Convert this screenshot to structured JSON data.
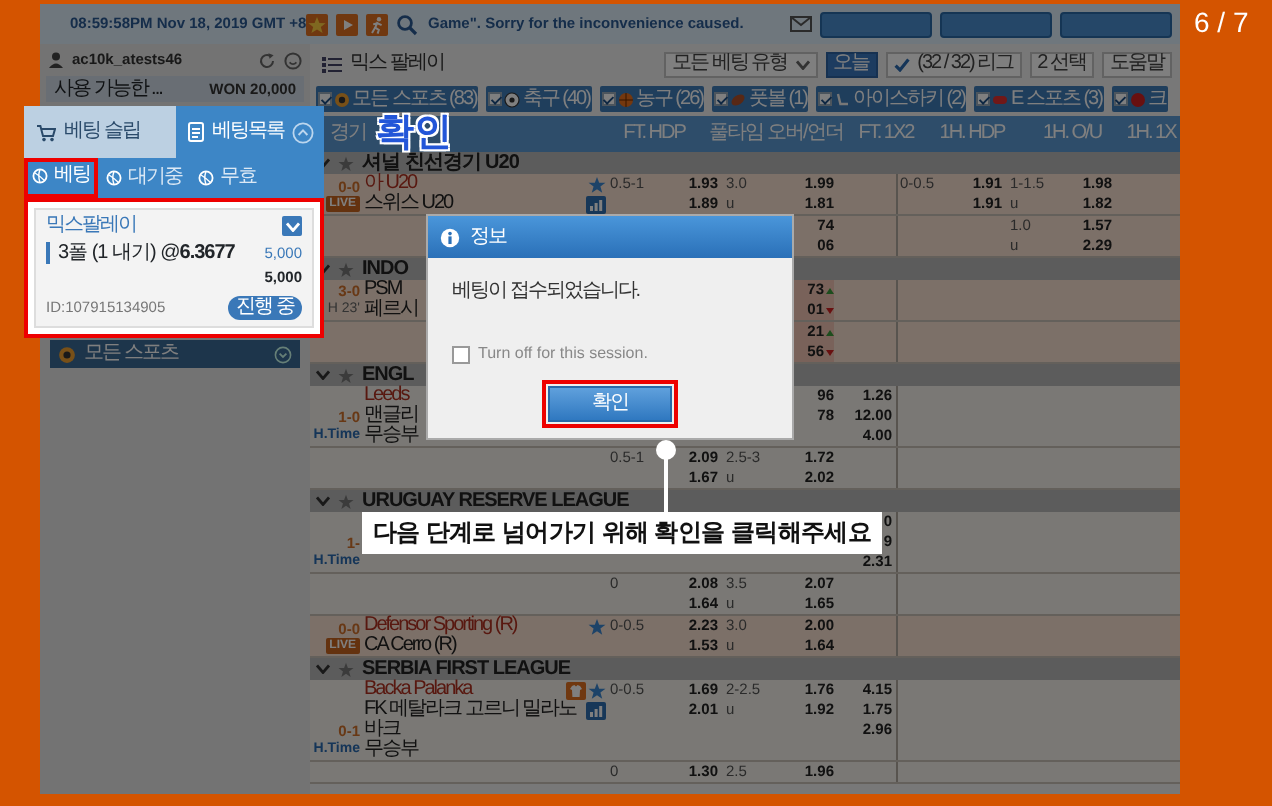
{
  "slide_counter": "6 / 7",
  "top_bar": {
    "clock": "08:59:58PM Nov 18, 2019 GMT +8",
    "notice": "Game\". Sorry for the inconvenience caused."
  },
  "account": {
    "username": "ac10k_atests46",
    "balance_label": "사용 가능한 ...",
    "balance": "WON 20,000"
  },
  "sidebar_sports": "모든 스포츠",
  "page_title": "믹스 팔레이",
  "filters": [
    {
      "label": "모든 베팅 유형",
      "kind": "dropdown",
      "selected": false
    },
    {
      "label": "오늘",
      "kind": "plain",
      "selected": true
    },
    {
      "label": "(32 / 32) 리그",
      "kind": "check",
      "selected": false
    },
    {
      "label": "2 선택",
      "kind": "plain",
      "selected": false
    },
    {
      "label": "도움말",
      "kind": "plain",
      "selected": false
    }
  ],
  "sport_tabs": [
    {
      "label": "모든 스포츠 (83)",
      "kind": "all",
      "checked": true
    },
    {
      "label": "축구 (40)",
      "kind": "soccer",
      "checked": true
    },
    {
      "label": "농구 (26)",
      "kind": "basketball",
      "checked": true
    },
    {
      "label": "풋볼 (1)",
      "kind": "football",
      "checked": true
    },
    {
      "label": "아이스하키 (2)",
      "kind": "hockey",
      "checked": true
    },
    {
      "label": "E 스포츠 (3)",
      "kind": "esports",
      "checked": true
    },
    {
      "label": "크",
      "kind": "other",
      "checked": true
    }
  ],
  "columns": [
    "경기",
    "FT. HDP",
    "풀타임 오버/언더",
    "FT. 1X2",
    "1H. HDP",
    "1H. O/U",
    "1H. 1X"
  ],
  "leagues": [
    {
      "name": "셔널 친선경기 U20",
      "matches": [
        {
          "score": "0-0",
          "status": {
            "text": "LIVE",
            "kind": "live"
          },
          "live": true,
          "teams": [
            {
              "name": "아 U20",
              "home": true
            },
            {
              "name": "스위스 U20",
              "home": false
            }
          ],
          "icon_rows": [
            [
              {
                "kind": "star"
              }
            ],
            [
              {
                "kind": "stats"
              }
            ]
          ],
          "lines": [
            {
              "hdp": "0.5-1",
              "hdp_odds": "1.93",
              "ou": "3.0",
              "ou_odds": "1.99",
              "h1_hdp": "0-0.5",
              "h1_hdp_odds": "1.91",
              "h1_ou": "1-1.5",
              "h1_ou_odds": "1.98"
            },
            {
              "hdp_odds": "1.89",
              "ou": "u",
              "ou_odds": "1.81",
              "h1_hdp_odds": "1.91",
              "h1_ou": "u",
              "h1_ou_odds": "1.82"
            }
          ]
        },
        {
          "live": true,
          "lines": [
            {
              "ou_odds": "74",
              "h1_ou": "1.0",
              "h1_ou_odds": "1.57"
            },
            {
              "ou_odds": "06",
              "h1_ou": "u",
              "h1_ou_odds": "2.29"
            }
          ]
        }
      ]
    },
    {
      "name": "INDO",
      "matches": [
        {
          "score": "3-0",
          "status": {
            "text": "H 23'",
            "kind": "clock"
          },
          "live": true,
          "teams": [
            {
              "name": "PSM",
              "home": false
            },
            {
              "name": "페르시",
              "home": false
            }
          ],
          "lines": [
            {
              "ou_odds": {
                "text": "73",
                "kind": "up"
              }
            },
            {
              "ou_odds": {
                "text": "01",
                "kind": "down"
              }
            }
          ]
        },
        {
          "live": true,
          "lines": [
            {
              "ou_odds": {
                "text": "21",
                "kind": "up"
              }
            },
            {
              "ou_odds": {
                "text": "56",
                "kind": "down"
              }
            }
          ]
        }
      ]
    },
    {
      "name": "ENGL",
      "matches": [
        {
          "score": "1-0",
          "status": {
            "text": "H.Time",
            "kind": "time"
          },
          "live": false,
          "teams": [
            {
              "name": "Leeds",
              "home": true
            },
            {
              "name": "맨글리",
              "home": false
            },
            {
              "name": "무승부",
              "home": false
            }
          ],
          "lines": [
            {
              "ou_odds": "96",
              "x12": "1.26"
            },
            {
              "ou_odds": "78",
              "x12": "12.00"
            },
            {
              "x12": "4.00"
            }
          ]
        },
        {
          "live": false,
          "lines": [
            {
              "hdp": "0.5-1",
              "hdp_odds": "2.09",
              "ou": "2.5-3",
              "ou_odds": "1.72"
            },
            {
              "hdp_odds": "1.67",
              "ou": "u",
              "ou_odds": "2.02"
            }
          ]
        }
      ]
    },
    {
      "name": "URUGUAY RESERVE LEAGUE",
      "matches": [
        {
          "score": "1-",
          "status": {
            "text": "H.Time",
            "kind": "time"
          },
          "live": false,
          "lines": [
            {
              "x12": "0"
            },
            {
              "x12": "9"
            },
            {
              "x12": "2.31"
            }
          ]
        },
        {
          "live": false,
          "lines": [
            {
              "hdp": "0",
              "hdp_odds": "2.08",
              "ou": "3.5",
              "ou_odds": "2.07"
            },
            {
              "hdp_odds": "1.64",
              "ou": "u",
              "ou_odds": "1.65"
            }
          ]
        },
        {
          "score": "0-0",
          "status": {
            "text": "LIVE",
            "kind": "live"
          },
          "live": true,
          "teams": [
            {
              "name": "Defensor Sporting (R)",
              "home": true
            },
            {
              "name": "CA Cerro (R)",
              "home": false
            }
          ],
          "icon_rows": [
            [
              {
                "kind": "star"
              }
            ]
          ],
          "lines": [
            {
              "hdp": "0-0.5",
              "hdp_odds": "2.23",
              "ou": "3.0",
              "ou_odds": "2.00"
            },
            {
              "hdp_odds": "1.53",
              "ou": "u",
              "ou_odds": "1.64"
            }
          ]
        }
      ]
    },
    {
      "name": "SERBIA FIRST LEAGUE",
      "matches": [
        {
          "score": "0-1",
          "status": {
            "text": "H.Time",
            "kind": "time"
          },
          "live": false,
          "teams": [
            {
              "name": "Backa Palanka",
              "home": true
            },
            {
              "name": "FK 메탈라크 고르니 밀라노바크",
              "home": false
            },
            {
              "name": "무승부",
              "home": false
            }
          ],
          "icon_rows": [
            [
              {
                "kind": "jersey"
              },
              {
                "kind": "star"
              }
            ],
            [
              {
                "kind": "stats"
              }
            ]
          ],
          "lines": [
            {
              "hdp": "0-0.5",
              "hdp_odds": "1.69",
              "ou": "2-2.5",
              "ou_odds": "1.76",
              "x12": "4.15"
            },
            {
              "hdp_odds": "2.01",
              "ou": "u",
              "ou_odds": "1.92",
              "x12": "1.75"
            },
            {
              "x12": "2.96"
            }
          ]
        },
        {
          "live": false,
          "lines": [
            {
              "hdp": "0",
              "hdp_odds": "1.30",
              "ou": "2.5",
              "ou_odds": "1.96"
            }
          ]
        }
      ]
    }
  ],
  "bet_panel": {
    "tabs": [
      {
        "label": "베팅 슬립",
        "kind": "slip",
        "selected": false
      },
      {
        "label": "베팅목록",
        "kind": "list",
        "selected": true
      }
    ],
    "sub_tabs": [
      {
        "label": "베팅",
        "selected": true
      },
      {
        "label": "대기중",
        "selected": false
      },
      {
        "label": "무효",
        "selected": false
      }
    ],
    "bet": {
      "type": "믹스팔레이",
      "detail": "3폴 (1 내기) @**6.3677**",
      "stake": "5,000",
      "total": "5,000",
      "id": "ID:107915134905",
      "status": "진행 중"
    }
  },
  "dialog": {
    "title": "정보",
    "message": "베팅이 접수되었습니다.",
    "checkbox": {
      "label": "Turn off for this session.",
      "checked": false
    },
    "button": "확인"
  },
  "highlight_label": "확인",
  "callout": "다음 단계로 넘어가기 위해 확인을 클릭해주세요"
}
